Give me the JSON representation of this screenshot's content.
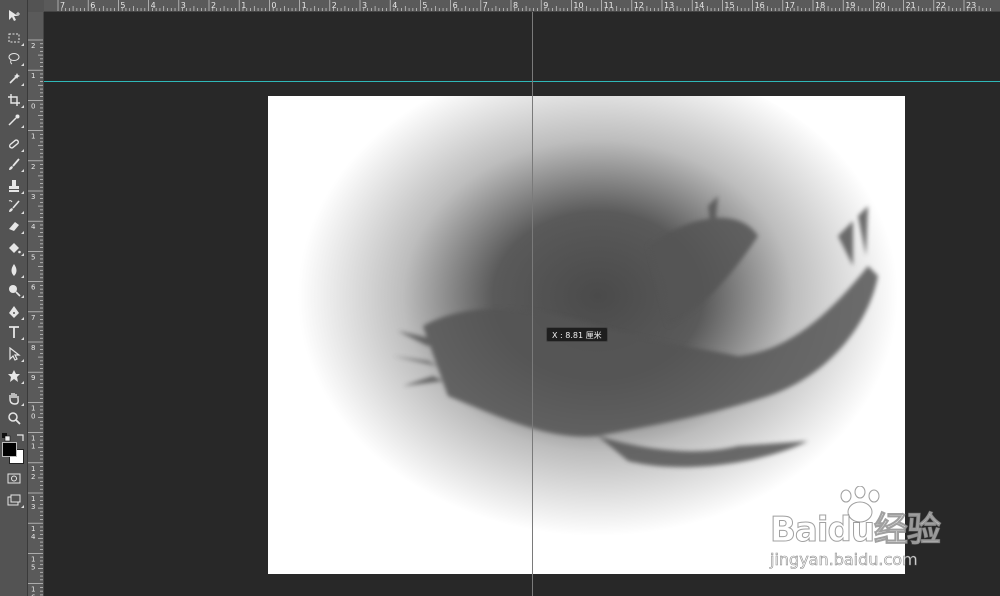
{
  "app": {
    "name": "Photoshop-like editor"
  },
  "rulers": {
    "horizontal_labels": [
      "7",
      "6",
      "5",
      "4",
      "3",
      "2",
      "1",
      "0",
      "1",
      "2",
      "3",
      "4",
      "5",
      "6",
      "7",
      "8",
      "9",
      "10",
      "11",
      "12",
      "13",
      "14",
      "15",
      "16",
      "17",
      "18",
      "19",
      "20",
      "21",
      "22",
      "23"
    ],
    "vertical_labels": [
      "2",
      "1",
      "0",
      "1",
      "2",
      "3",
      "4",
      "5",
      "6",
      "7",
      "8",
      "9",
      "1\n0",
      "1\n1",
      "1\n2",
      "1\n3",
      "1\n4",
      "1\n5",
      "1\n6"
    ]
  },
  "tools": [
    {
      "name": "move-tool-icon"
    },
    {
      "name": "marquee-tool-icon"
    },
    {
      "name": "lasso-tool-icon"
    },
    {
      "name": "magic-wand-tool-icon"
    },
    {
      "name": "crop-tool-icon"
    },
    {
      "name": "eyedropper-tool-icon"
    },
    {
      "name": "healing-brush-tool-icon"
    },
    {
      "name": "brush-tool-icon"
    },
    {
      "name": "clone-stamp-tool-icon"
    },
    {
      "name": "history-brush-tool-icon"
    },
    {
      "name": "eraser-tool-icon"
    },
    {
      "name": "paint-bucket-tool-icon"
    },
    {
      "name": "blur-tool-icon"
    },
    {
      "name": "dodge-tool-icon"
    },
    {
      "name": "pen-tool-icon"
    },
    {
      "name": "type-tool-icon"
    },
    {
      "name": "path-selection-tool-icon"
    },
    {
      "name": "shape-tool-icon"
    },
    {
      "name": "hand-tool-icon"
    },
    {
      "name": "zoom-tool-icon"
    }
  ],
  "colors": {
    "foreground": "#000000",
    "background": "#ffffff",
    "guide": "#2fb8b8",
    "workspace": "#282828"
  },
  "tooltip": {
    "text": "X : 8.81 厘米"
  },
  "watermark": {
    "brand": "Baidu经验",
    "sub": "jingyan.baidu.com"
  }
}
